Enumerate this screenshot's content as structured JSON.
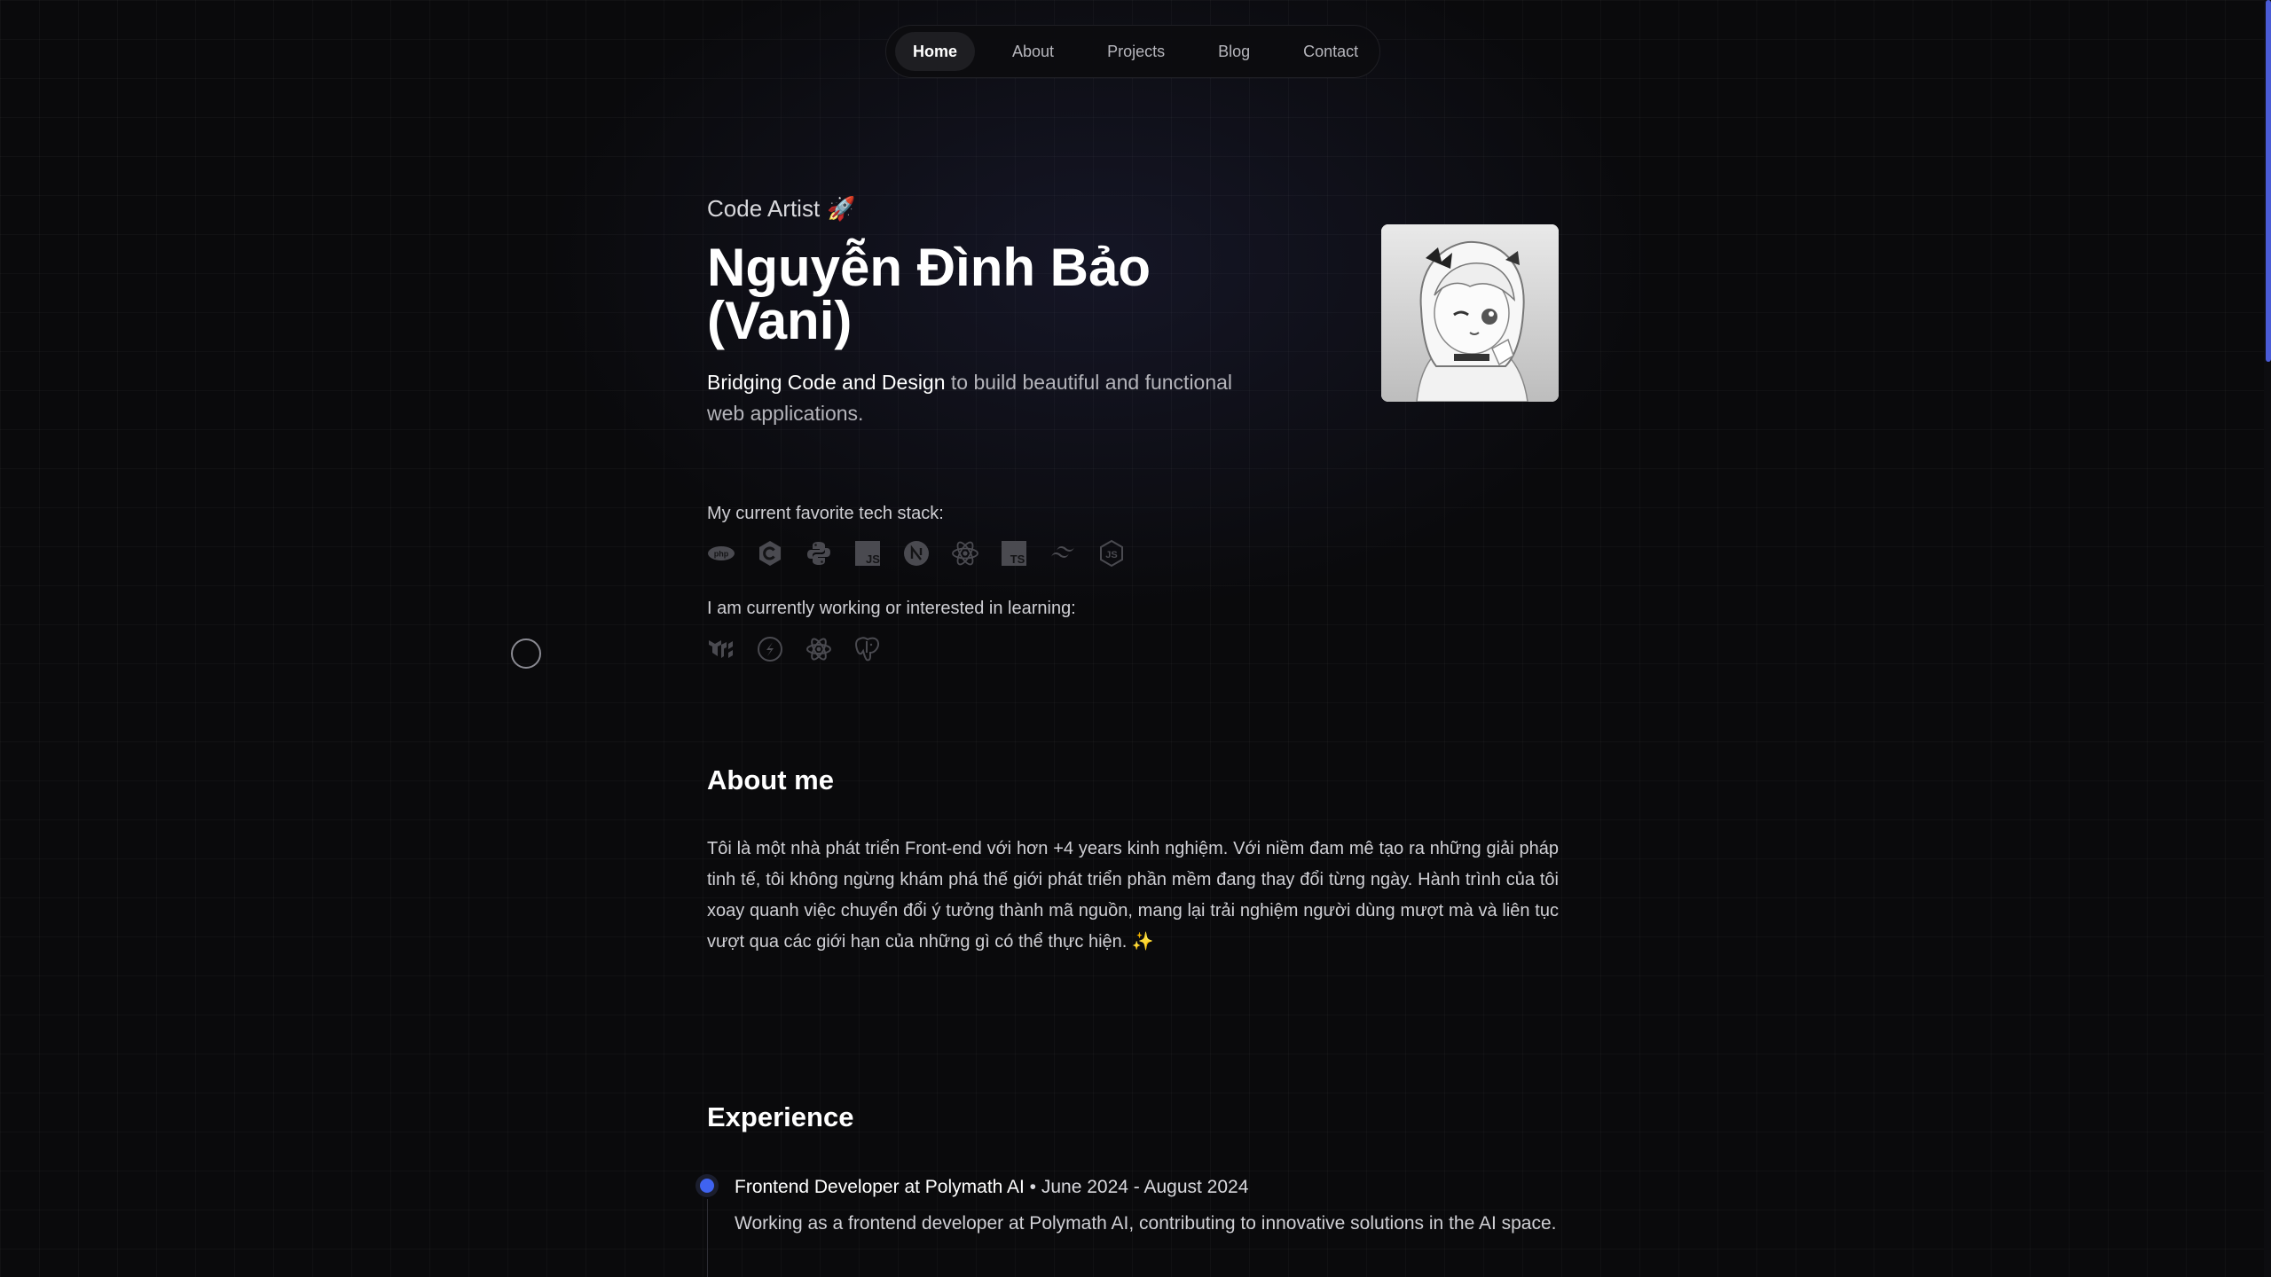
{
  "nav": {
    "items": [
      {
        "label": "Home",
        "active": true
      },
      {
        "label": "About",
        "active": false
      },
      {
        "label": "Projects",
        "active": false
      },
      {
        "label": "Blog",
        "active": false
      },
      {
        "label": "Contact",
        "active": false
      }
    ]
  },
  "hero": {
    "role": "Code Artist",
    "role_emoji": "🚀",
    "name": "Nguyễn Đình Bảo (Vani)",
    "tagline_highlight": "Bridging Code and Design",
    "tagline_rest": " to build beautiful and functional web applications.",
    "avatar_icon": "anime-girl-avatar"
  },
  "tech_stack": {
    "label": "My current favorite tech stack:",
    "icons": [
      "php-icon",
      "csharp-icon",
      "python-icon",
      "javascript-icon",
      "nextjs-icon",
      "react-icon",
      "typescript-icon",
      "tailwind-icon",
      "nodejs-icon"
    ]
  },
  "learning": {
    "label": "I am currently working or interested in learning:",
    "icons": [
      "mui-icon",
      "svelte-icon",
      "react-native-icon",
      "postgresql-icon"
    ]
  },
  "about": {
    "title": "About me",
    "text": "Tôi là một nhà phát triển Front-end với hơn +4 years kinh nghiệm. Với niềm đam mê tạo ra những giải pháp tinh tế, tôi không ngừng khám phá thế giới phát triển phần mềm đang thay đổi từng ngày. Hành trình của tôi xoay quanh việc chuyển đổi ý tưởng thành mã nguồn, mang lại trải nghiệm người dùng mượt mà và liên tục vượt qua các giới hạn của những gì có thể thực hiện. ✨"
  },
  "experience": {
    "title": "Experience",
    "items": [
      {
        "role": "Frontend Developer at Polymath AI",
        "dates": " • June 2024 - August 2024",
        "description": "Working as a frontend developer at Polymath AI, contributing to innovative solutions in the AI space."
      }
    ]
  },
  "colors": {
    "accent": "#3f63f0",
    "scroll_thumb": "#4a5bd6",
    "background": "#0a0a0c"
  }
}
